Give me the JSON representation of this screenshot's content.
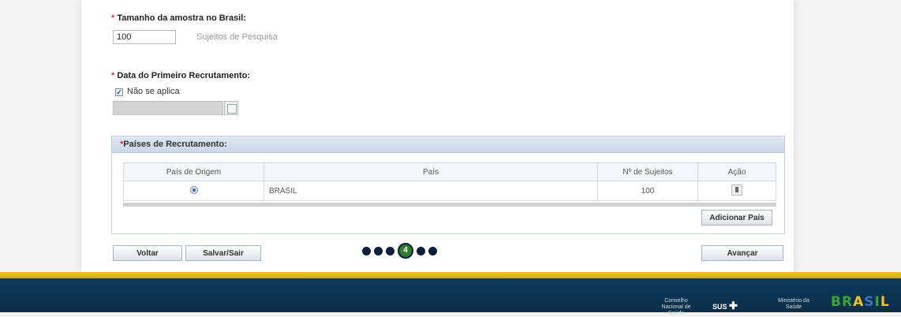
{
  "sample_size": {
    "label": "Tamanho da amostra no Brasil:",
    "required_mark": "*",
    "value": "100",
    "unit_hint": "Sujeitos de Pesquisa"
  },
  "first_recruitment": {
    "label": "Data do Primeiro Recrutamento:",
    "required_mark": "*",
    "not_applicable_label": "Não se aplica",
    "not_applicable_checked": true
  },
  "recruitment_countries": {
    "title": "Países de Recrutamento:",
    "required_mark": "*",
    "columns": [
      "País de Origem",
      "País",
      "Nº de Sujeitos",
      "Ação"
    ],
    "rows": [
      {
        "origin_selected": true,
        "country": "BRASIL",
        "subjects": "100"
      }
    ],
    "add_button": "Adicionar País"
  },
  "nav": {
    "back_button": "Voltar",
    "save_exit_button": "Salvar/Sair",
    "next_button": "Avançar",
    "current_step": "4",
    "steps_before": 3,
    "steps_after": 2
  },
  "footer": {
    "cns_text": "Conselho Nacional de Saúde",
    "sus_text": "SUS",
    "ministry_text": "Ministério da Saúde",
    "brasil_text": "BRASIL",
    "colors": {
      "footer_bg": "#0b2e49",
      "gold_bar": "#e4a21d"
    }
  }
}
